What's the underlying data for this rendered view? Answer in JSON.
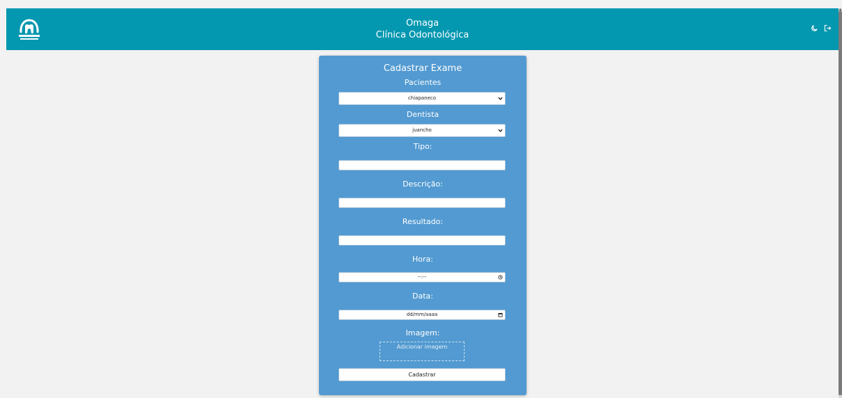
{
  "header": {
    "title_line1": "Omaga",
    "title_line2": "Clínica Odontológica",
    "background": "#0497b0",
    "icons": [
      "theme-toggle-icon",
      "logout-icon"
    ]
  },
  "form": {
    "title": "Cadastrar Exame",
    "background": "#529ad1",
    "pacientes_label": "Pacientes",
    "pacientes_value": "chiapaneco",
    "dentista_label": "Dentista",
    "dentista_value": "juancho",
    "tipo_label": "Tipo:",
    "descricao_label": "Descrição:",
    "resultado_label": "Resultado:",
    "hora_label": "Hora:",
    "hora_placeholder": "--:--",
    "data_label": "Data:",
    "data_placeholder": "dd/mm/aaaa",
    "imagem_label": "Imagem:",
    "imagem_button": "Adicionar imagem",
    "submit_label": "Cadastrar"
  }
}
